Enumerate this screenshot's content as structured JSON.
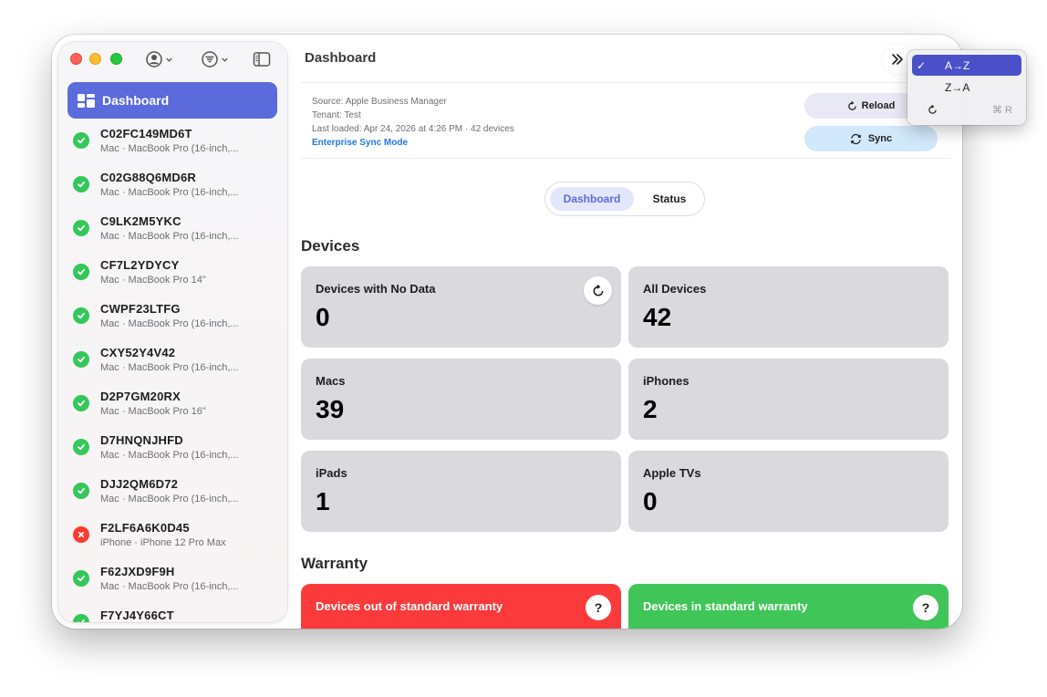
{
  "window": {
    "title": "Dashboard"
  },
  "sidebar": {
    "active_item": {
      "label": "Dashboard",
      "icon": "dashboard-icon"
    },
    "devices": [
      {
        "serial": "C02FC149MD6T",
        "model": "Mac · MacBook Pro (16-inch,...",
        "status": "ok"
      },
      {
        "serial": "C02G88Q6MD6R",
        "model": "Mac · MacBook Pro (16-inch,...",
        "status": "ok"
      },
      {
        "serial": "C9LK2M5YKC",
        "model": "Mac · MacBook Pro (16-inch,...",
        "status": "ok"
      },
      {
        "serial": "CF7L2YDYCY",
        "model": "Mac · MacBook Pro 14\"",
        "status": "ok"
      },
      {
        "serial": "CWPF23LTFG",
        "model": "Mac · MacBook Pro (16-inch,...",
        "status": "ok"
      },
      {
        "serial": "CXY52Y4V42",
        "model": "Mac · MacBook Pro (16-inch,...",
        "status": "ok"
      },
      {
        "serial": "D2P7GM20RX",
        "model": "Mac · MacBook Pro 16\"",
        "status": "ok"
      },
      {
        "serial": "D7HNQNJHFD",
        "model": "Mac · MacBook Pro (16-inch,...",
        "status": "ok"
      },
      {
        "serial": "DJJ2QM6D72",
        "model": "Mac · MacBook Pro (16-inch,...",
        "status": "ok"
      },
      {
        "serial": "F2LF6A6K0D45",
        "model": "iPhone · iPhone 12 Pro Max",
        "status": "error"
      },
      {
        "serial": "F62JXD9F9H",
        "model": "Mac · MacBook Pro (16-inch,...",
        "status": "ok"
      },
      {
        "serial": "F7YJ4Y66CT",
        "model": "",
        "status": "ok"
      }
    ]
  },
  "info": {
    "source": "Source: Apple Business Manager",
    "tenant": "Tenant: Test",
    "last_loaded": "Last loaded: Apr 24, 2026 at 4:26 PM · 42 devices",
    "mode_link": "Enterprise Sync Mode"
  },
  "actions": {
    "reload": "Reload",
    "sync": "Sync"
  },
  "segmented": {
    "active": "Dashboard",
    "other": "Status"
  },
  "devices_section": {
    "heading": "Devices",
    "cards": {
      "no_data": {
        "title": "Devices with No Data",
        "value": "0"
      },
      "all": {
        "title": "All Devices",
        "value": "42"
      },
      "macs": {
        "title": "Macs",
        "value": "39"
      },
      "iphones": {
        "title": "iPhones",
        "value": "2"
      },
      "ipads": {
        "title": "iPads",
        "value": "1"
      },
      "appletvs": {
        "title": "Apple TVs",
        "value": "0"
      }
    }
  },
  "warranty_section": {
    "heading": "Warranty",
    "out": {
      "title": "Devices out of standard warranty",
      "help": "?"
    },
    "in": {
      "title": "Devices in standard warranty",
      "help": "?"
    }
  },
  "sort_menu": {
    "items": [
      {
        "label": "A→Z",
        "checked": "✓"
      },
      {
        "label": "Z→A"
      }
    ],
    "reload_shortcut": "⌘ R"
  },
  "colors": {
    "accent": "#5b6bdc",
    "ok": "#34c759",
    "error": "#ff3b30",
    "warranty_out": "#fb3a3c",
    "warranty_in": "#40c558"
  }
}
